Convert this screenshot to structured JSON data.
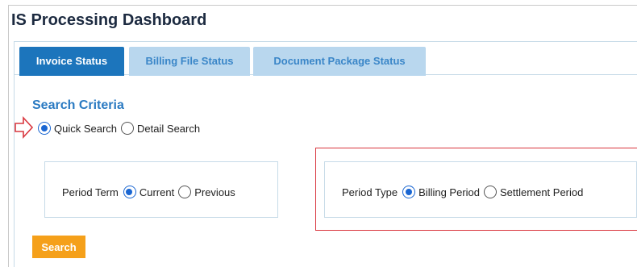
{
  "page": {
    "title": "IS Processing Dashboard"
  },
  "tabs": [
    {
      "label": "Invoice Status",
      "active": true
    },
    {
      "label": "Billing File Status",
      "active": false
    },
    {
      "label": "Document Package Status",
      "active": false
    }
  ],
  "search": {
    "title": "Search Criteria",
    "mode_options": [
      {
        "label": "Quick Search",
        "checked": true
      },
      {
        "label": "Detail Search",
        "checked": false
      }
    ],
    "period_term": {
      "label": "Period Term",
      "options": [
        {
          "label": "Current",
          "checked": true
        },
        {
          "label": "Previous",
          "checked": false
        }
      ]
    },
    "period_type": {
      "label": "Period Type",
      "options": [
        {
          "label": "Billing Period",
          "checked": true
        },
        {
          "label": "Settlement Period",
          "checked": false
        }
      ]
    },
    "button_label": "Search"
  },
  "colors": {
    "accent_blue": "#1c75bc",
    "tab_inactive_bg": "#b9d7ee",
    "highlight_red": "#d9363e",
    "button_orange": "#f5a01a"
  },
  "icons": {
    "annotation": "red-arrow-right-icon"
  }
}
